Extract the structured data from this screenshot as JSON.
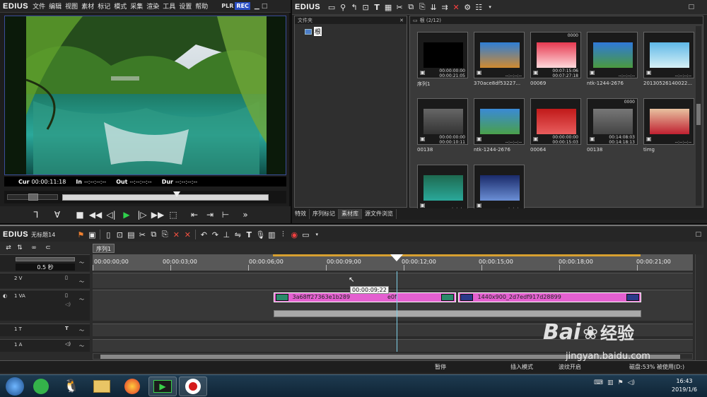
{
  "player": {
    "logo": "EDIUS",
    "menu": [
      "文件",
      "编辑",
      "视图",
      "素材",
      "标记",
      "模式",
      "采集",
      "渲染",
      "工具",
      "设置",
      "帮助"
    ],
    "plr": "PLR",
    "rec": "REC",
    "timecodes": {
      "cur_label": "Cur",
      "cur": "00:00:11:18",
      "in_label": "In",
      "in": "--:--:--:--",
      "out_label": "Out",
      "out": "--:--:--:--",
      "dur_label": "Dur",
      "dur": "--:--:--:--"
    }
  },
  "bin": {
    "logo": "EDIUS",
    "folder_pane": {
      "title": "文件夹",
      "root": "根"
    },
    "clip_header": "根 (2/12)",
    "clips": [
      {
        "name": "序列1",
        "tc1": "00:00:00:00",
        "tc2": "00:00:21:05",
        "badge": ""
      },
      {
        "name": "370ace8df53227...",
        "tc1": "",
        "tc2": "--:--:--:--",
        "badge": ""
      },
      {
        "name": "00069",
        "tc1": "00:07:15:06",
        "tc2": "00:07:27:18",
        "badge": "0000"
      },
      {
        "name": "ntk-1244-2676",
        "tc1": "",
        "tc2": "--:--:--:--",
        "badge": ""
      },
      {
        "name": "20130526140022...",
        "tc1": "",
        "tc2": "--:--:--:--",
        "badge": ""
      },
      {
        "name": "00138",
        "tc1": "00:00:00:00",
        "tc2": "00:00:10:11",
        "badge": ""
      },
      {
        "name": "ntk-1244-2676",
        "tc1": "",
        "tc2": "--:--:--:--",
        "badge": ""
      },
      {
        "name": "00064",
        "tc1": "00:00:00:00",
        "tc2": "00:00:15:03",
        "badge": ""
      },
      {
        "name": "00138",
        "tc1": "00:14:08:03",
        "tc2": "00:14:18:13",
        "badge": "0000"
      },
      {
        "name": "timg",
        "tc1": "",
        "tc2": "--:--:--:--",
        "badge": ""
      },
      {
        "name": "",
        "tc1": "",
        "tc2": "--:--:--:--",
        "badge": ""
      },
      {
        "name": "",
        "tc1": "",
        "tc2": "--:--:--:--",
        "badge": ""
      }
    ],
    "tabs": [
      "特效",
      "序列标记",
      "素材库",
      "源文件浏览"
    ],
    "active_tab": 2
  },
  "timeline": {
    "logo": "EDIUS",
    "project": "无标题14",
    "sequence_tab": "序列1",
    "zoom": "0.5 秒",
    "ruler": [
      "00:00:00;00",
      "00:00:03;00",
      "00:00:06;00",
      "00:00:09;00",
      "00:00:12;00",
      "00:00:15;00",
      "00:00:18;00",
      "00:00:21;00"
    ],
    "tracks": {
      "v2": "2 V",
      "va1": "1 VA",
      "t1": "1 T",
      "a1": "1 A"
    },
    "clip1": "3a68ff27363e1b289",
    "clip1_tail": "e0f",
    "clip2": "1440x900_2d7edf917d28899",
    "tooltip": "00:00:09;22"
  },
  "status": {
    "pause": "暂停",
    "insert_mode": "插入模式",
    "ripple": "波纹开启",
    "disk": "磁盘:53% 被使用(D:)"
  },
  "taskbar": {
    "time": "16:43",
    "date": "2019/1/6"
  },
  "watermark": {
    "brand": "Bai",
    "brand2": "经验",
    "url": "jingyan.baidu.com"
  }
}
